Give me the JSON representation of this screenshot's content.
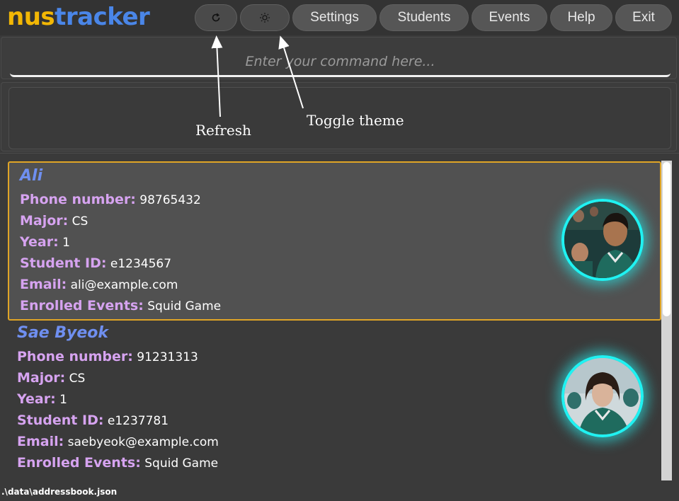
{
  "app": {
    "logo_part1": "nus",
    "logo_part2": "tracker"
  },
  "nav": {
    "refresh_icon": "refresh-icon",
    "theme_icon": "sun-icon",
    "settings": "Settings",
    "students": "Students",
    "events": "Events",
    "help": "Help",
    "exit": "Exit"
  },
  "command": {
    "placeholder": "Enter your command here...",
    "value": ""
  },
  "annotations": {
    "refresh": "Refresh",
    "toggle_theme": "Toggle theme"
  },
  "students": [
    {
      "name": "Ali",
      "phone_label": "Phone number:",
      "phone": "98765432",
      "major_label": "Major:",
      "major": "CS",
      "year_label": "Year:",
      "year": "1",
      "id_label": "Student ID:",
      "id": "e1234567",
      "email_label": "Email:",
      "email": "ali@example.com",
      "events_label": "Enrolled Events:",
      "events": "Squid Game",
      "selected": true
    },
    {
      "name": "Sae Byeok",
      "phone_label": "Phone number:",
      "phone": "91231313",
      "major_label": "Major:",
      "major": "CS",
      "year_label": "Year:",
      "year": "1",
      "id_label": "Student ID:",
      "id": "e1237781",
      "email_label": "Email:",
      "email": "saebyeok@example.com",
      "events_label": "Enrolled Events:",
      "events": "Squid Game",
      "selected": false
    }
  ],
  "status": {
    "path": ".\\data\\addressbook.json"
  },
  "colors": {
    "accent_yellow": "#f2b705",
    "accent_blue": "#4a86e8",
    "label_purple": "#d6a3f0",
    "name_blue": "#6f8ff0",
    "avatar_ring": "#1ff2f2",
    "selected_border": "#e0a526"
  }
}
